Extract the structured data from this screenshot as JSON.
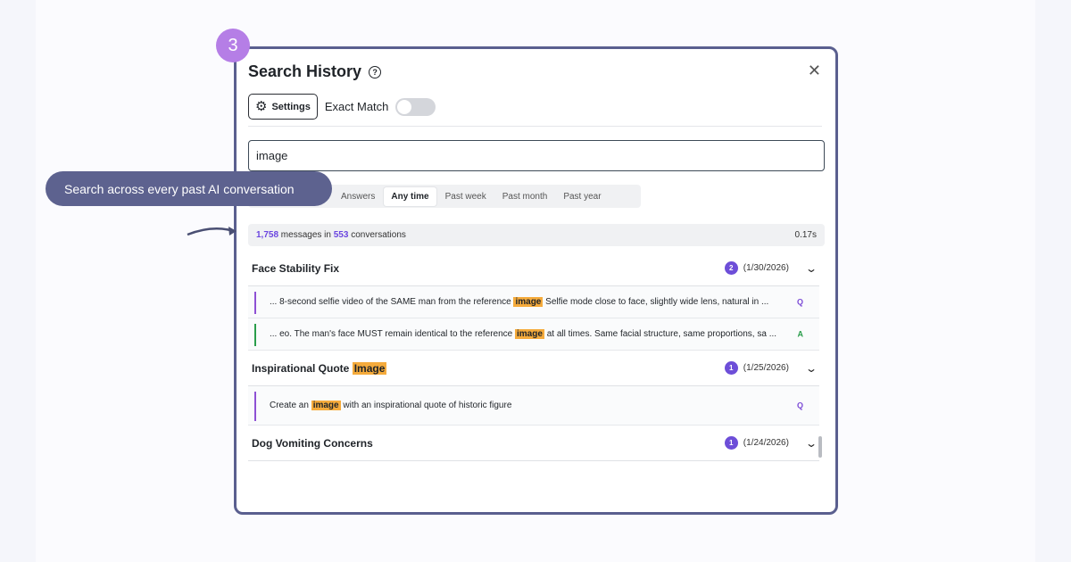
{
  "step_number": "3",
  "callout_text": "Search across every past AI conversation",
  "modal": {
    "title": "Search History",
    "help_icon": "?",
    "close_icon": "✕",
    "settings_label": "Settings",
    "exact_match_label": "Exact Match",
    "exact_match_on": false,
    "search_value": "image",
    "filters": [
      "Answers",
      "Any time",
      "Past week",
      "Past month",
      "Past year"
    ],
    "active_filter": "Any time",
    "stats": {
      "messages": "1,758",
      "messages_text": " messages in ",
      "conversations": "553",
      "conversations_text": " conversations",
      "time": "0.17s"
    },
    "groups": [
      {
        "title_pre": "Face Stability Fix",
        "title_hl": "",
        "count": "2",
        "date": "(1/30/2026)",
        "messages": [
          {
            "role": "Q",
            "pre": "... 8-second selfie video of the SAME man from the reference ",
            "hl": "image",
            "post": " Selfie mode close to face, slightly wide lens, natural in ..."
          },
          {
            "role": "A",
            "pre": "... eo. The man's face MUST remain identical to the reference ",
            "hl": "image",
            "post": " at all times. Same facial structure, same proportions, sa ..."
          }
        ]
      },
      {
        "title_pre": "Inspirational Quote ",
        "title_hl": "Image",
        "count": "1",
        "date": "(1/25/2026)",
        "messages": [
          {
            "role": "Q",
            "pre": "Create an ",
            "hl": "image",
            "post": " with an inspirational quote of historic figure"
          }
        ]
      },
      {
        "title_pre": "Dog Vomiting Concerns",
        "title_hl": "",
        "count": "1",
        "date": "(1/24/2026)",
        "messages": []
      }
    ]
  },
  "colors": {
    "accent_purple": "#6b46e0",
    "highlight": "#f5ab3c",
    "callout_bg": "#5d628f",
    "step_badge": "#b57ee6"
  }
}
